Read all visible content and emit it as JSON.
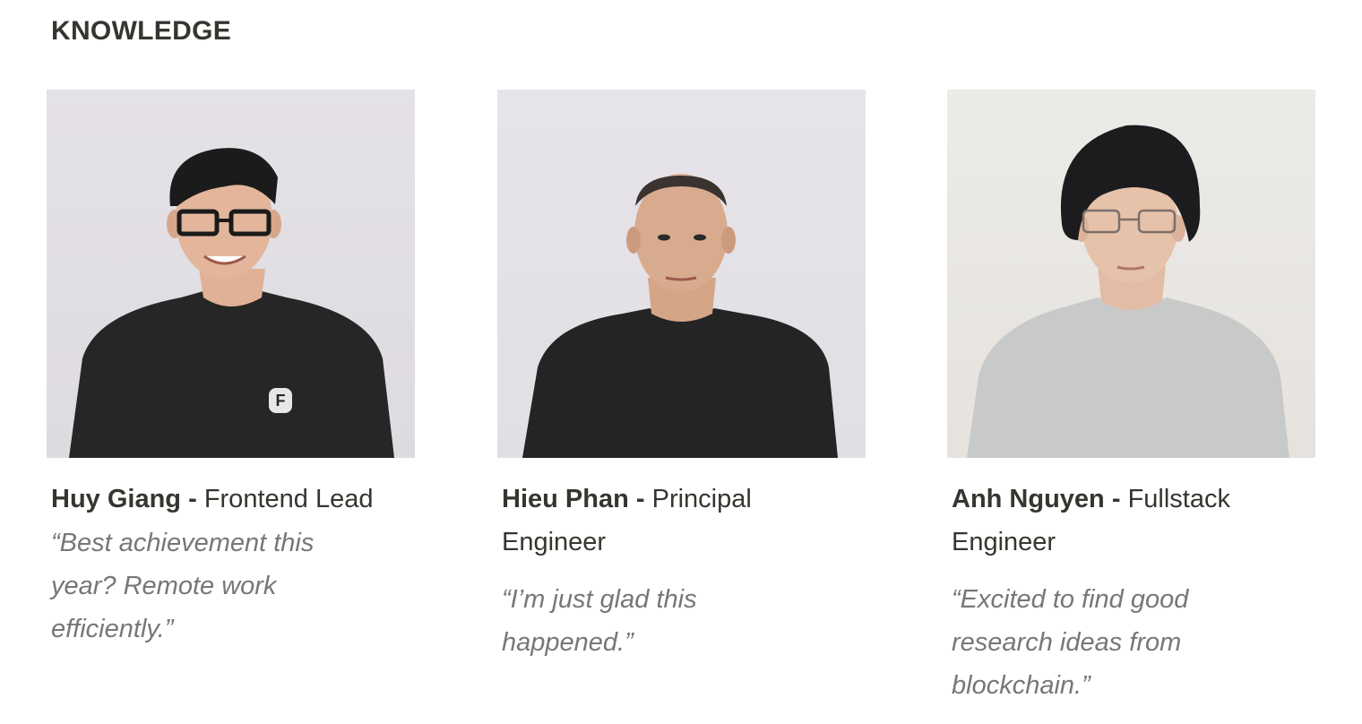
{
  "section": {
    "title": "KNOWLEDGE"
  },
  "members": [
    {
      "name": "Huy Giang",
      "separator": "-",
      "role": "Frontend Lead",
      "quote": "“Best achievement this year? Remote work efficiently.”",
      "shirt_logo": "F"
    },
    {
      "name": "Hieu Phan",
      "separator": "-",
      "role": "Principal Engineer",
      "quote": "“I’m just glad this happened.”"
    },
    {
      "name": "Anh Nguyen",
      "separator": "-",
      "role": "Fullstack Engineer",
      "quote": "“Excited to find good research ideas from blockchain.”"
    }
  ],
  "colors": {
    "heading": "#37352f",
    "quote": "#787774",
    "photo_background": "#e6e3e6"
  }
}
